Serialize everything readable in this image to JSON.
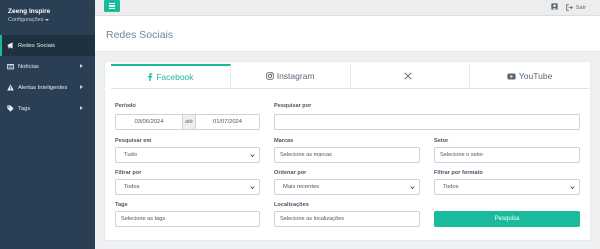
{
  "brand": {
    "name": "Zeeng Inspire",
    "sub": "Configurações"
  },
  "sidebar": {
    "items": [
      {
        "label": "Redes Sociais",
        "icon": "megaphone-icon"
      },
      {
        "label": "Notícias",
        "icon": "newspaper-icon"
      },
      {
        "label": "Alertas Inteligentes",
        "icon": "warning-icon"
      },
      {
        "label": "Tags",
        "icon": "tags-icon"
      }
    ]
  },
  "topbar": {
    "logout_label": "Sair"
  },
  "page": {
    "title": "Redes Sociais"
  },
  "tabs": [
    {
      "label": "Facebook",
      "icon": "facebook-icon"
    },
    {
      "label": "Instagram",
      "icon": "instagram-icon"
    },
    {
      "label": "",
      "icon": "x-icon"
    },
    {
      "label": "YouTube",
      "icon": "youtube-icon"
    }
  ],
  "filters": {
    "periodo": {
      "label": "Período",
      "start": "03/06/2024",
      "sep": "até",
      "end": "01/07/2024"
    },
    "pesquisar_por": {
      "label": "Pesquisar por",
      "value": ""
    },
    "pesquisar_em": {
      "label": "Pesquisar em",
      "value": "Tudo"
    },
    "marcas": {
      "label": "Marcas",
      "placeholder": "Selecione as marcas"
    },
    "setor": {
      "label": "Setor",
      "placeholder": "Selecione o setor"
    },
    "filtrar_por": {
      "label": "Filtrar por",
      "value": "Todos"
    },
    "ordenar_por": {
      "label": "Ordenar por",
      "value": "Mais recentes"
    },
    "filtrar_formato": {
      "label": "Filtrar por formato",
      "value": "Todos"
    },
    "tags": {
      "label": "Tags",
      "placeholder": "Selecione as tags"
    },
    "localizacoes": {
      "label": "Localizações",
      "placeholder": "Selecione as localizações"
    },
    "search_button": "Pesquisa"
  },
  "colors": {
    "accent": "#1abb9c",
    "sidebar": "#2a3f54"
  }
}
